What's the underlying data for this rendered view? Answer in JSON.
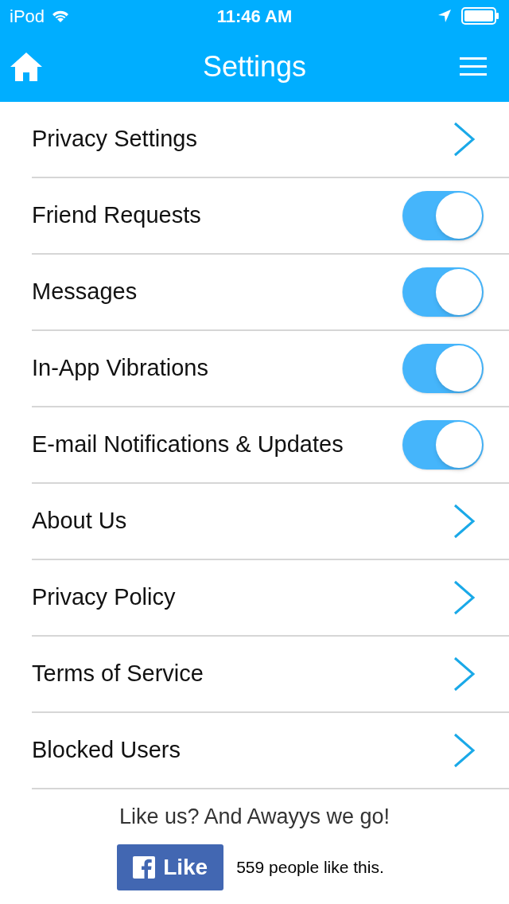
{
  "status_bar": {
    "carrier": "iPod",
    "time": "11:46 AM"
  },
  "nav": {
    "title": "Settings"
  },
  "rows": [
    {
      "kind": "link",
      "label": "Privacy Settings"
    },
    {
      "kind": "toggle",
      "label": "Friend Requests",
      "on": true
    },
    {
      "kind": "toggle",
      "label": "Messages",
      "on": true
    },
    {
      "kind": "toggle",
      "label": "In-App Vibrations",
      "on": true
    },
    {
      "kind": "toggle",
      "label": "E-mail Notifications & Updates",
      "on": true
    },
    {
      "kind": "link",
      "label": "About Us"
    },
    {
      "kind": "link",
      "label": "Privacy Policy"
    },
    {
      "kind": "link",
      "label": "Terms of Service"
    },
    {
      "kind": "link",
      "label": "Blocked Users"
    }
  ],
  "footer": {
    "tagline": "Like us? And Awayys we go!",
    "like_button": "Like",
    "like_count": "559 people like this."
  }
}
